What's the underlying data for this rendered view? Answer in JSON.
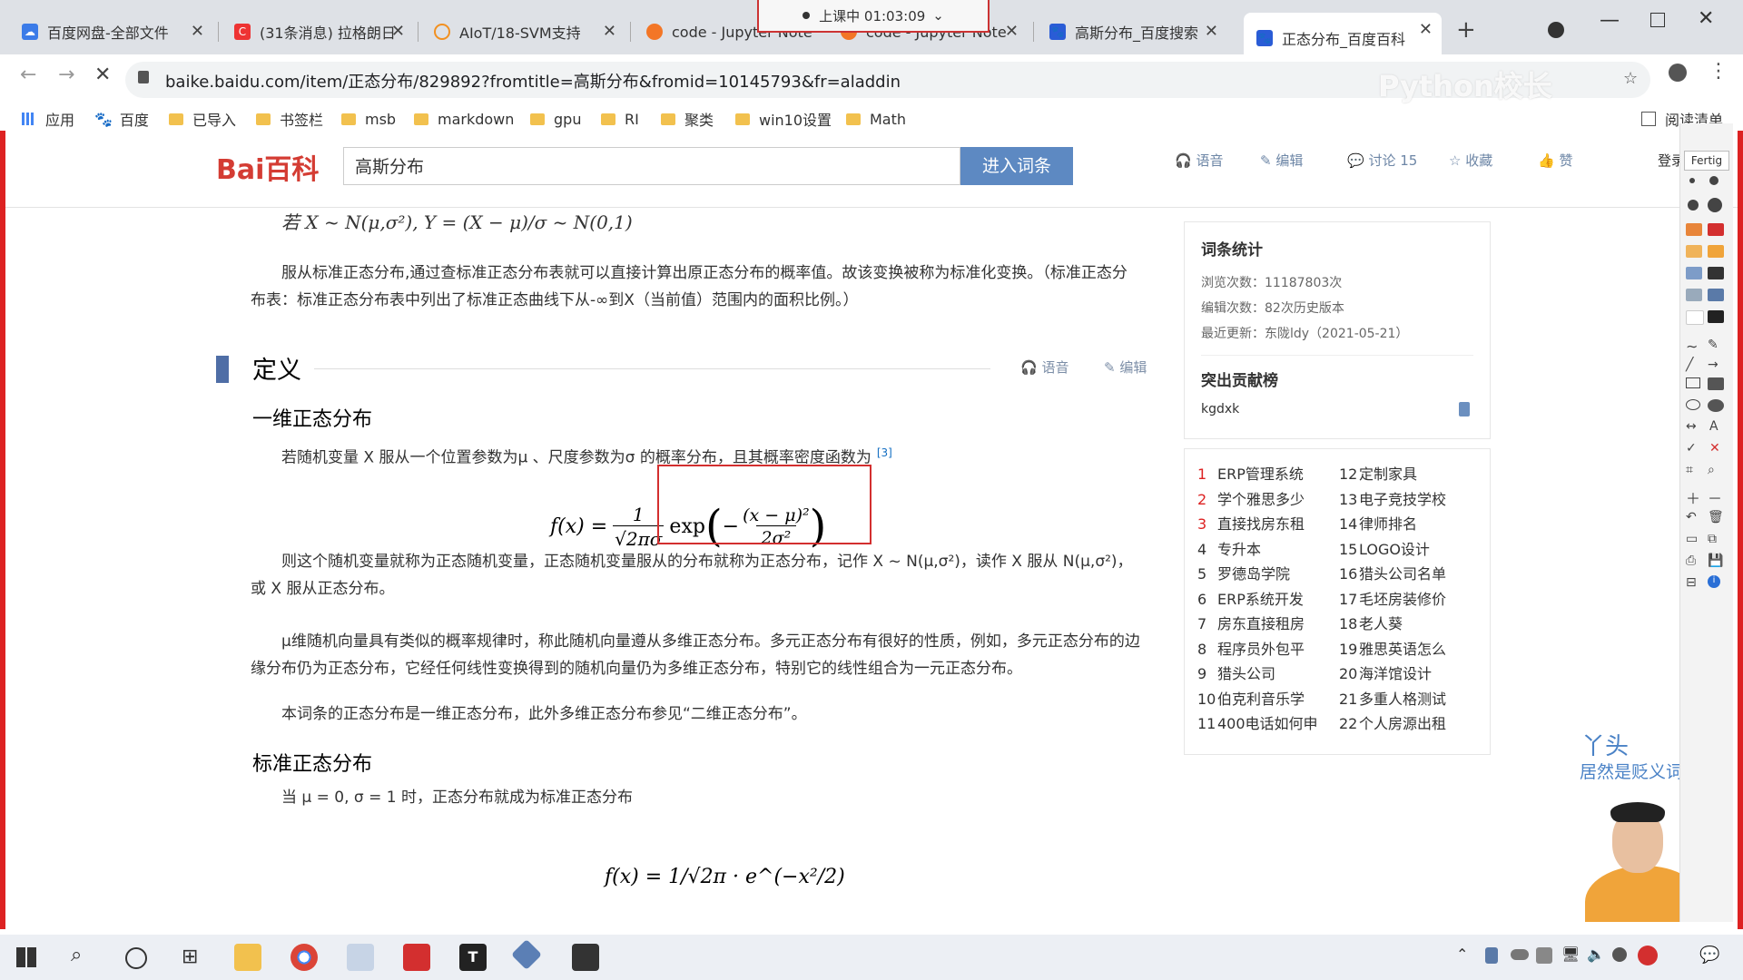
{
  "recording_badge": "上课中 01:03:09",
  "tabs": [
    {
      "title": "百度网盘-全部文件",
      "icon": "baidu-pan-icon"
    },
    {
      "title": "(31条消息) 拉格朗日",
      "icon": "csdn-icon"
    },
    {
      "title": "AIoT/18-SVM支持",
      "icon": "loading-icon"
    },
    {
      "title": "code - Jupyter Note",
      "icon": "jupyter-icon"
    },
    {
      "title": "code - Jupyter Note",
      "icon": "jupyter-icon"
    },
    {
      "title": "高斯分布_百度搜索",
      "icon": "baidu-icon"
    },
    {
      "title": "正态分布_百度百科",
      "icon": "baidu-icon"
    }
  ],
  "url": "baike.baidu.com/item/正态分布/829892?fromtitle=高斯分布&fromid=10145793&fr=aladdin",
  "watermark": "Python校长",
  "bookmarks": [
    "应用",
    "百度",
    "已导入",
    "书签栏",
    "msb",
    "markdown",
    "gpu",
    "RI",
    "聚类",
    "win10设置",
    "Math"
  ],
  "reading_list": "阅读清单",
  "header": {
    "logo": "Bai百科",
    "search_value": "高斯分布",
    "search_button": "进入词条",
    "actions": [
      "语音",
      "编辑",
      "讨论 15",
      "收藏",
      "赞"
    ],
    "login": "登录"
  },
  "article": {
    "top_formula": "若 X ~ N(μ,σ²), Y = (X − μ)/σ ~ N(0,1)",
    "para1": "服从标准正态分布,通过查标准正态分布表就可以直接计算出原正态分布的概率值。故该变换被称为标准化变换。（标准正态分布表：标准正态分布表中列出了标准正态曲线下从-∞到X（当前值）范围内的面积比例。）",
    "section_title": "定义",
    "section_voice": "语音",
    "section_edit": "编辑",
    "sub1": "一维正态分布",
    "sub1_text": "若随机变量 X 服从一个位置参数为μ 、尺度参数为σ 的概率分布，且其概率密度函数为",
    "ref": "[3]",
    "formula1_lhs": "f(x) =",
    "formula1_frac_num": "1",
    "formula1_frac_den": "√2πσ",
    "formula1_exp": "exp",
    "formula1_inner_num": "(x − μ)²",
    "formula1_inner_den": "2σ²",
    "para2": "则这个随机变量就称为正态随机变量，正态随机变量服从的分布就称为正态分布，记作 X ~ N(μ,σ²)，读作 X 服从 N(μ,σ²)，或 X 服从正态分布。",
    "para3": "μ维随机向量具有类似的概率规律时，称此随机向量遵从多维正态分布。多元正态分布有很好的性质，例如，多元正态分布的边缘分布仍为正态分布，它经任何线性变换得到的随机向量仍为多维正态分布，特别它的线性组合为一元正态分布。",
    "para4": "本词条的正态分布是一维正态分布，此外多维正态分布参见“二维正态分布”。",
    "sub2": "标准正态分布",
    "sub2_text": "当 μ = 0, σ = 1 时，正态分布就成为标准正态分布",
    "formula2": "f(x) = 1/√2π · e^(−x²/2)"
  },
  "sidebar": {
    "stats_title": "词条统计",
    "views": "浏览次数：11187803次",
    "edits": "编辑次数：82次历史版本",
    "updated": "最近更新：东陇ldy（2021-05-21）",
    "contrib_title": "突出贡献榜",
    "contributor": "kgdxk",
    "hot_left": [
      "ERP管理系统",
      "学个雅思多少",
      "直接找房东租",
      "专升本",
      "罗德岛学院",
      "ERP系统开发",
      "房东直接租房",
      "程序员外包平",
      "猎头公司",
      "伯克利音乐学",
      "400电话如何申"
    ],
    "hot_right": [
      "定制家具",
      "电子竞技学校",
      "律师排名",
      "LOGO设计",
      "猎头公司名单",
      "毛坯房装修价",
      "老人葵",
      "雅思英语怎么",
      "海洋馆设计",
      "多重人格测试",
      "个人房源出租"
    ]
  },
  "video_caption": {
    "line1": "丫头",
    "line2": "居然是贬义词?"
  },
  "drawbar_label": "Fertig",
  "colors": {
    "accent": "#d43c33",
    "link": "#136ec2",
    "button": "#5d89c2",
    "highlight_box": "#d32f2f"
  }
}
